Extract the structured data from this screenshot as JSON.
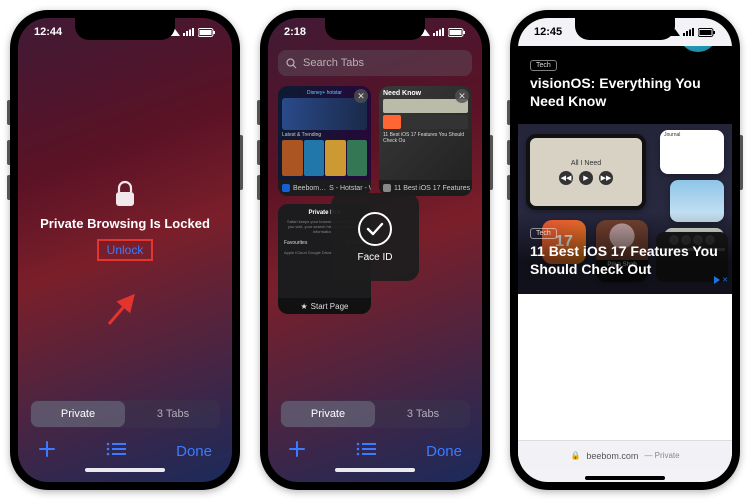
{
  "phone1": {
    "time": "12:44",
    "headline": "Private Browsing Is Locked",
    "unlock": "Unlock",
    "segment_private": "Private",
    "segment_tabs": "3 Tabs",
    "done": "Done"
  },
  "phone2": {
    "time": "2:18",
    "search_placeholder": "Search Tabs",
    "tabs": [
      {
        "label": "11 Best iOS 17 Features You…",
        "thumb_title": "Need Know"
      },
      {
        "label": "Beebom…",
        "thumb_title": ""
      },
      {
        "label": "S - Hotstar - W…",
        "thumb_title": "Latest & Trending"
      },
      {
        "label": "Start Page",
        "thumb_title": "Private Bro",
        "thumb_sub": "Favourites",
        "thumb_links": "Apple   iCloud   Google   Disney"
      }
    ],
    "faceid": "Face ID",
    "segment_private": "Private",
    "segment_tabs": "3 Tabs",
    "done": "Done"
  },
  "phone3": {
    "time": "12:45",
    "tag1": "Tech",
    "title1": "visionOS: Everything You Need Know",
    "hero_song": "All I Need",
    "hero_ios17": "17",
    "hero_contact": "Priya Shah",
    "tag2": "Tech",
    "title2": "11 Best iOS 17 Features You Should Check Out",
    "domain": "beebom.com",
    "private_label": "— Private",
    "ad_close": "✕"
  }
}
